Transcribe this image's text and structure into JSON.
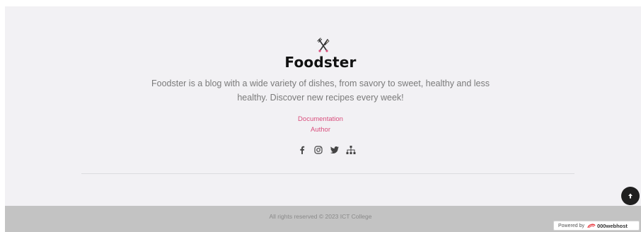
{
  "footer": {
    "brand": {
      "icon": "fork-knife-icon",
      "title": "Foodster",
      "description": "Foodster is a blog with a wide variety of dishes, from savory to sweet, healthy and less healthy. Discover new recipes every week!"
    },
    "links": [
      {
        "label": "Documentation"
      },
      {
        "label": "Author"
      }
    ],
    "social_icons": [
      "facebook-icon",
      "instagram-icon",
      "twitter-icon",
      "sitemap-icon"
    ],
    "link_color": "#d94f7d"
  },
  "back_to_top": {
    "icon": "arrow-up-icon"
  },
  "copyright": {
    "text": "All rights reserved © 2023 ICT College"
  },
  "badge": {
    "prefix": "Powered by",
    "host": "000webhost"
  }
}
